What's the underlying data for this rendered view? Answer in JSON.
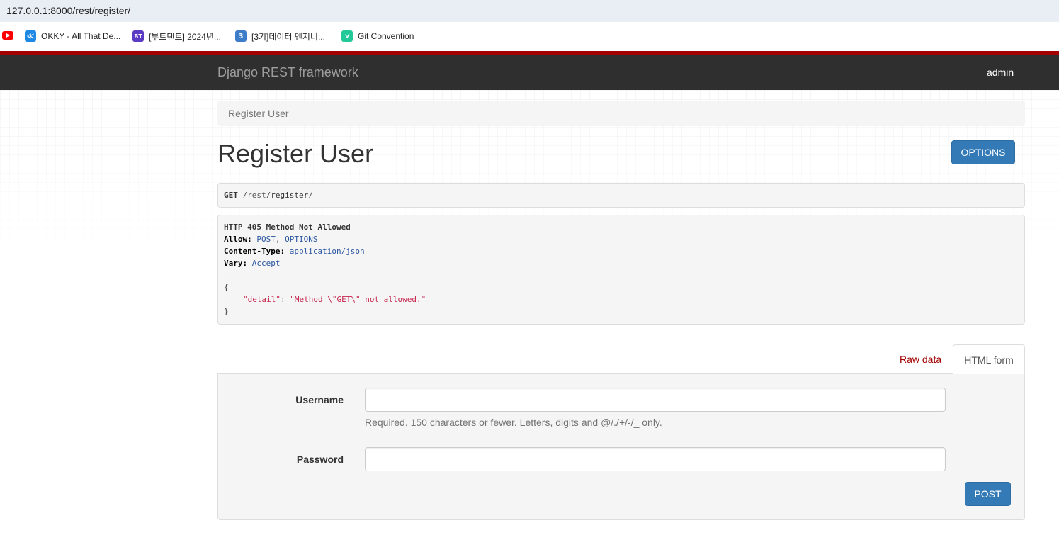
{
  "browser": {
    "url": "127.0.0.1:8000/rest/register/",
    "bookmarks": [
      {
        "icon": "youtube-icon",
        "label": ""
      },
      {
        "icon": "okky-icon",
        "label": "OKKY - All That De...",
        "fav": "≪",
        "color": "#1e88e5"
      },
      {
        "icon": "bootcamp-icon",
        "label": "[부트텐트] 2024년...",
        "fav": "BT",
        "color": "#5b3cc4"
      },
      {
        "icon": "number-3-icon",
        "label": "[3기]데이터 엔지니...",
        "fav": "3",
        "color": "#3d7cc9"
      },
      {
        "icon": "velog-icon",
        "label": "Git Convention",
        "fav": "v",
        "color": "#20c997"
      }
    ]
  },
  "navbar": {
    "brand": "Django REST framework",
    "user": "admin"
  },
  "breadcrumb": "Register User",
  "page_title": "Register User",
  "options_button": "OPTIONS",
  "request": {
    "method": "GET",
    "path_prefix": " /rest/",
    "path_main": "register",
    "path_suffix": "/"
  },
  "response": {
    "status_line": "HTTP 405 Method Not Allowed",
    "allow_key": "Allow:",
    "allow_val1": "POST",
    "allow_sep": ",",
    "allow_val2": "OPTIONS",
    "ct_key": "Content-Type:",
    "ct_val": "application/json",
    "vary_key": "Vary:",
    "vary_val": "Accept",
    "open_brace": "{",
    "json_key": "\"detail\"",
    "colon": ": ",
    "json_val": "\"Method \\\"GET\\\" not allowed.\"",
    "close_brace": "}"
  },
  "tabs": {
    "raw": "Raw data",
    "html": "HTML form"
  },
  "form": {
    "username_label": "Username",
    "username_value": "",
    "username_help": "Required. 150 characters or fewer. Letters, digits and @/./+/-/_ only.",
    "password_label": "Password",
    "password_value": "",
    "submit": "POST"
  },
  "colors": {
    "navbar": "#2f2f2f",
    "accent_red": "#a30000",
    "primary": "#337ab7"
  }
}
